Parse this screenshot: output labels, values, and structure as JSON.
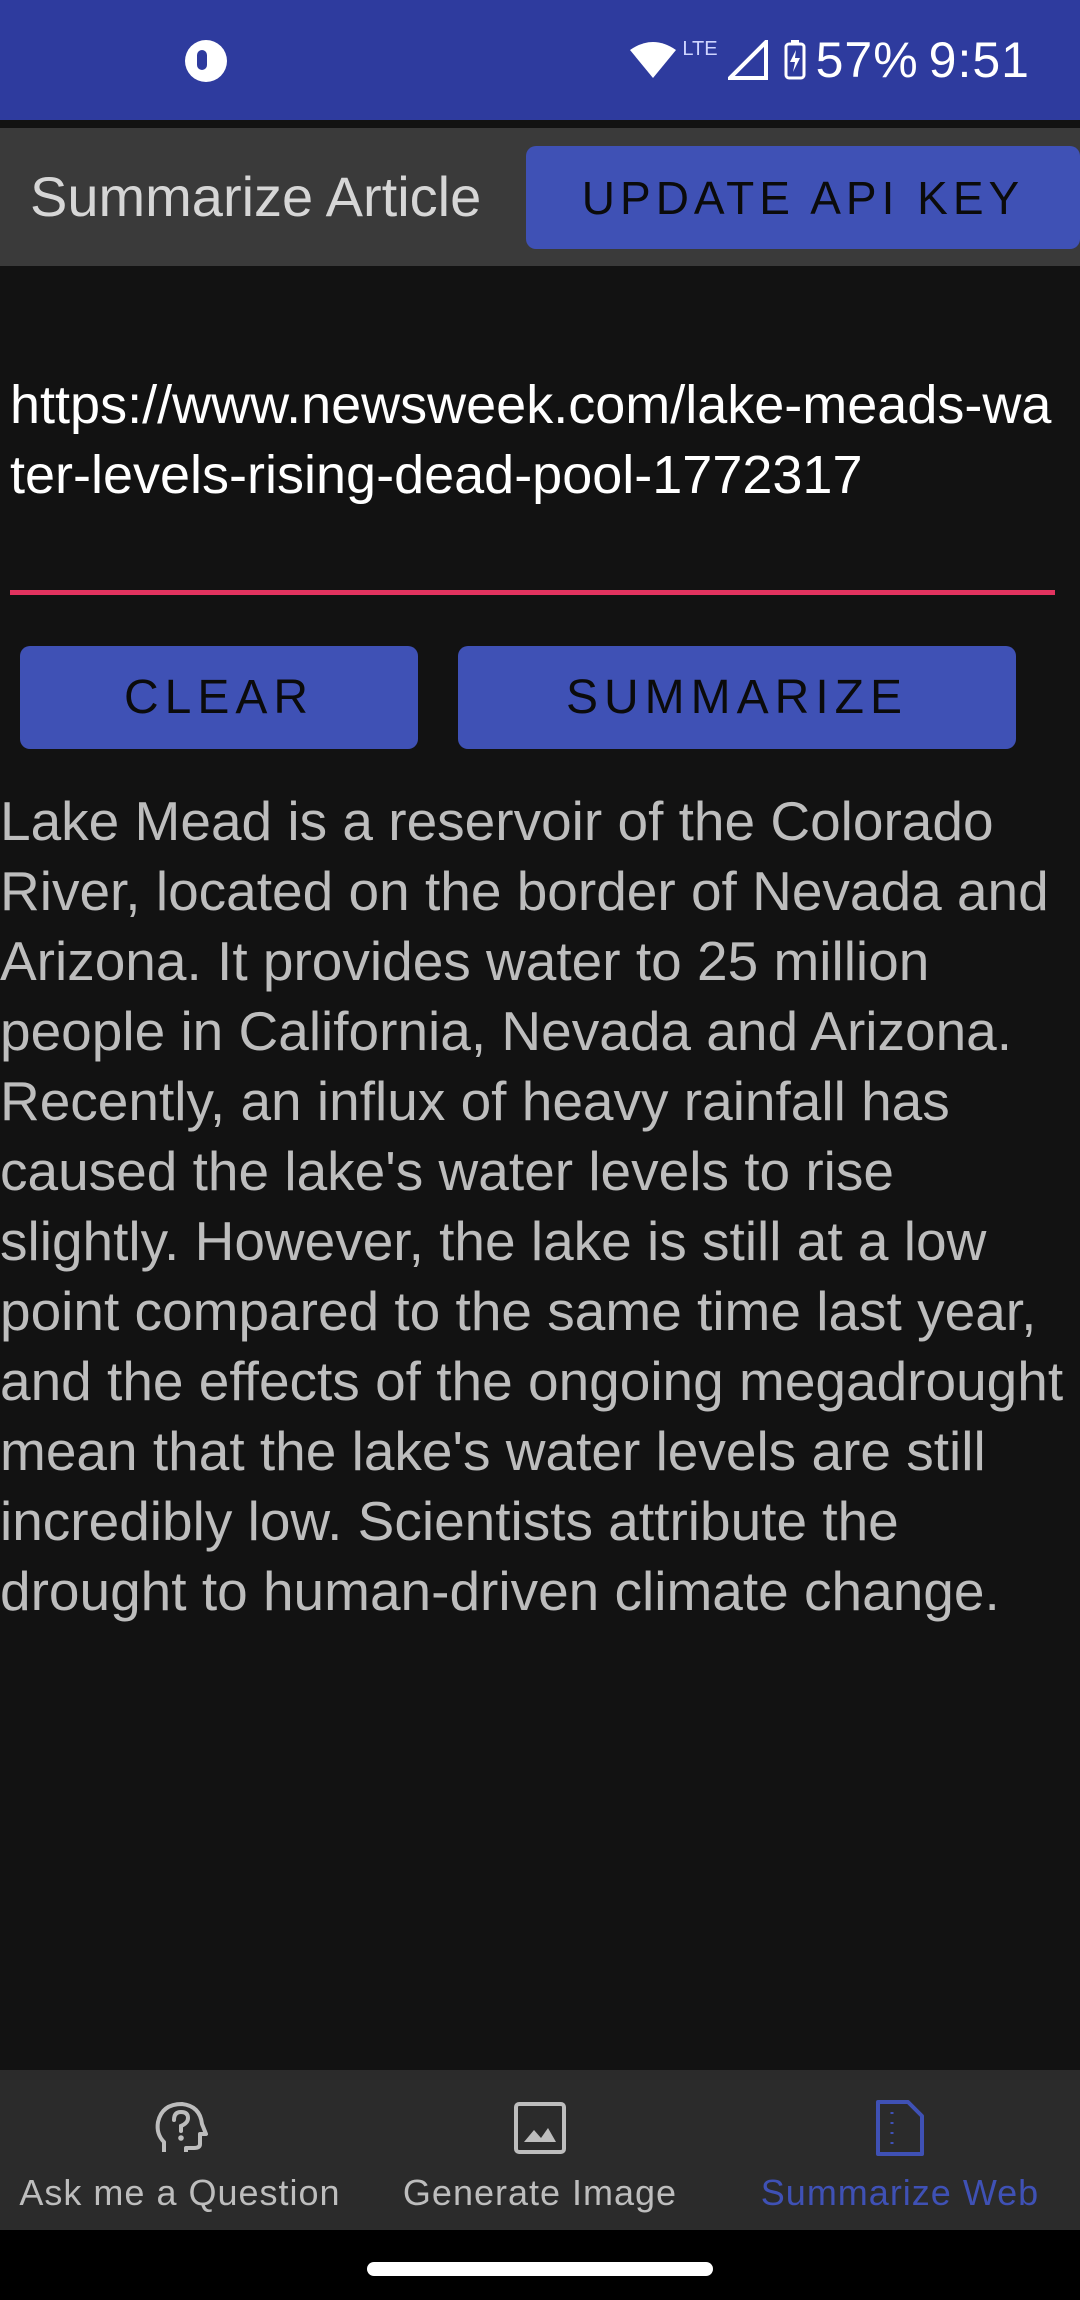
{
  "status_bar": {
    "network_label": "LTE",
    "battery": "57%",
    "time": "9:51"
  },
  "app_bar": {
    "title": "Summarize Article",
    "api_button_label": "UPDATE API KEY"
  },
  "form": {
    "url_value": "https://www.newsweek.com/lake-meads-water-levels-rising-dead-pool-1772317",
    "clear_label": "CLEAR",
    "summarize_label": "SUMMARIZE"
  },
  "summary": {
    "text": "Lake Mead is a reservoir of the Colorado River, located on the border of Nevada and Arizona. It provides water to 25 million people in California, Nevada and Arizona. Recently, an influx of heavy rainfall has caused the lake's water levels to rise slightly. However, the lake is still at a low point compared to the same time last year, and the effects of the ongoing megadrought mean that the lake's water levels are still incredibly low. Scientists attribute the drought to human-driven climate change."
  },
  "bottom_nav": {
    "items": [
      {
        "label": "Ask me a Question",
        "icon": "question-head-icon",
        "active": false
      },
      {
        "label": "Generate Image",
        "icon": "image-icon",
        "active": false
      },
      {
        "label": "Summarize Web",
        "icon": "document-icon",
        "active": true
      }
    ]
  },
  "colors": {
    "status_bar": "#2e3b9e",
    "accent": "#3f51b5",
    "underline": "#e2335f",
    "background": "#121212"
  }
}
